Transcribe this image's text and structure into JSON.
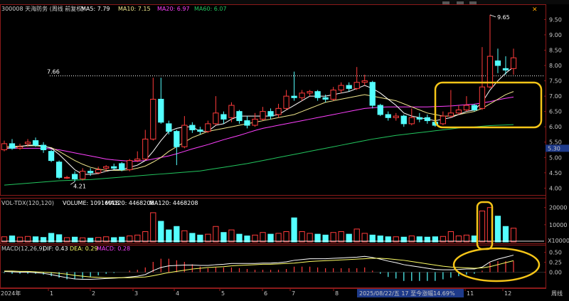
{
  "header": {
    "symbol": "300008 天海防务 (周线 前复权)",
    "ma5_label": "MA5: 7.79",
    "ma10_label": "MA10: 7.15",
    "ma20_label": "MA20: 6.97",
    "ma60_label": "MA60: 6.07"
  },
  "annotations": {
    "high": "9.65",
    "resistance": "7.66",
    "low": "4.21",
    "current_price": "5.30"
  },
  "volume_header": {
    "indicator": "VOL-TDX(120,120)",
    "volume": "VOLUME: 10916918",
    "ma120": "MA120: 4468208",
    "ma120b": "MA120: 4468208",
    "unit": "X10000"
  },
  "macd_header": {
    "indicator": "MACD(12,26,9)",
    "dif": "DIF: 0.43",
    "dea": "DEA: 0.29",
    "macd": "MACD: 0.28"
  },
  "bottom_bar": {
    "year": "2024年",
    "months": [
      "1",
      "2",
      "3",
      "4",
      "5",
      "6",
      "7",
      "8",
      "9",
      "10",
      "11",
      "12"
    ],
    "status": "2025/08/22/五 17 至今涨幅14.69%",
    "right_label": "周线"
  },
  "colors": {
    "up": "#ff3b3b",
    "down": "#54ffff",
    "ma5": "#ffffff",
    "ma10": "#f0e68c",
    "ma20": "#ff40ff",
    "ma60": "#22c55e",
    "highlight": "#f5c518"
  },
  "chart_data": [
    {
      "type": "candlestick",
      "title": "300008 天海防务 (周线 前复权)",
      "ylim": [
        3.8,
        9.95
      ],
      "y_ticks": [
        "9.50",
        "9.00",
        "8.50",
        "8.00",
        "7.50",
        "7.00",
        "6.50",
        "6.00",
        "5.50",
        "5.00",
        "4.50",
        "4.00"
      ],
      "candles": [
        {
          "o": 5.25,
          "c": 5.45,
          "h": 5.55,
          "l": 5.2
        },
        {
          "o": 5.45,
          "c": 5.3,
          "h": 5.6,
          "l": 5.25
        },
        {
          "o": 5.3,
          "c": 5.35,
          "h": 5.45,
          "l": 5.25
        },
        {
          "o": 5.45,
          "c": 5.5,
          "h": 5.6,
          "l": 5.35
        },
        {
          "o": 5.55,
          "c": 5.4,
          "h": 5.65,
          "l": 5.35
        },
        {
          "o": 5.4,
          "c": 5.25,
          "h": 5.5,
          "l": 5.15
        },
        {
          "o": 5.2,
          "c": 4.9,
          "h": 5.25,
          "l": 4.85
        },
        {
          "o": 4.85,
          "c": 4.35,
          "h": 4.9,
          "l": 4.3
        },
        {
          "o": 4.35,
          "c": 4.35,
          "h": 4.4,
          "l": 4.3
        },
        {
          "o": 4.45,
          "c": 4.3,
          "h": 4.55,
          "l": 4.21
        },
        {
          "o": 4.3,
          "c": 4.55,
          "h": 4.65,
          "l": 4.25
        },
        {
          "o": 4.55,
          "c": 4.5,
          "h": 4.65,
          "l": 4.4
        },
        {
          "o": 4.5,
          "c": 4.6,
          "h": 4.7,
          "l": 4.45
        },
        {
          "o": 4.65,
          "c": 4.7,
          "h": 4.75,
          "l": 4.55
        },
        {
          "o": 4.7,
          "c": 4.65,
          "h": 4.8,
          "l": 4.6
        },
        {
          "o": 4.8,
          "c": 4.6,
          "h": 4.85,
          "l": 4.55
        },
        {
          "o": 4.6,
          "c": 4.9,
          "h": 4.95,
          "l": 4.55
        },
        {
          "o": 4.9,
          "c": 4.95,
          "h": 5.2,
          "l": 4.85
        },
        {
          "o": 4.95,
          "c": 5.6,
          "h": 5.9,
          "l": 4.9
        },
        {
          "o": 5.6,
          "c": 6.9,
          "h": 7.6,
          "l": 5.55
        },
        {
          "o": 6.9,
          "c": 6.15,
          "h": 7.6,
          "l": 6.1
        },
        {
          "o": 6.1,
          "c": 5.85,
          "h": 6.2,
          "l": 5.75
        },
        {
          "o": 5.85,
          "c": 5.35,
          "h": 5.9,
          "l": 4.75
        },
        {
          "o": 5.35,
          "c": 6.05,
          "h": 6.35,
          "l": 5.3
        },
        {
          "o": 6.05,
          "c": 5.9,
          "h": 6.15,
          "l": 5.8
        },
        {
          "o": 5.9,
          "c": 5.85,
          "h": 6.0,
          "l": 5.75
        },
        {
          "o": 5.85,
          "c": 6.1,
          "h": 6.2,
          "l": 5.8
        },
        {
          "o": 6.1,
          "c": 6.45,
          "h": 7.0,
          "l": 6.05
        },
        {
          "o": 6.4,
          "c": 6.25,
          "h": 6.5,
          "l": 6.1
        },
        {
          "o": 6.3,
          "c": 6.7,
          "h": 6.8,
          "l": 6.15
        },
        {
          "o": 6.5,
          "c": 6.2,
          "h": 6.55,
          "l": 6.1
        },
        {
          "o": 6.2,
          "c": 6.05,
          "h": 6.35,
          "l": 5.95
        },
        {
          "o": 6.05,
          "c": 6.25,
          "h": 6.45,
          "l": 6.0
        },
        {
          "o": 6.25,
          "c": 6.5,
          "h": 6.65,
          "l": 6.2
        },
        {
          "o": 6.5,
          "c": 6.35,
          "h": 6.6,
          "l": 6.25
        },
        {
          "o": 6.4,
          "c": 6.6,
          "h": 6.75,
          "l": 6.3
        },
        {
          "o": 6.6,
          "c": 7.0,
          "h": 7.2,
          "l": 6.55
        },
        {
          "o": 7.0,
          "c": 6.95,
          "h": 7.8,
          "l": 6.85
        },
        {
          "o": 6.95,
          "c": 7.1,
          "h": 7.2,
          "l": 6.85
        },
        {
          "o": 7.1,
          "c": 7.15,
          "h": 7.2,
          "l": 7.0
        },
        {
          "o": 7.15,
          "c": 6.95,
          "h": 7.2,
          "l": 6.85
        },
        {
          "o": 6.95,
          "c": 6.9,
          "h": 7.05,
          "l": 6.8
        },
        {
          "o": 6.9,
          "c": 7.2,
          "h": 7.3,
          "l": 6.85
        },
        {
          "o": 7.2,
          "c": 7.35,
          "h": 7.45,
          "l": 7.1
        },
        {
          "o": 7.35,
          "c": 7.25,
          "h": 7.45,
          "l": 7.15
        },
        {
          "o": 7.25,
          "c": 7.45,
          "h": 7.95,
          "l": 7.2
        },
        {
          "o": 7.45,
          "c": 7.5,
          "h": 7.7,
          "l": 7.35
        },
        {
          "o": 7.45,
          "c": 6.7,
          "h": 7.5,
          "l": 6.6
        },
        {
          "o": 6.7,
          "c": 6.4,
          "h": 6.75,
          "l": 6.35
        },
        {
          "o": 6.4,
          "c": 6.3,
          "h": 6.5,
          "l": 6.2
        },
        {
          "o": 6.3,
          "c": 6.35,
          "h": 6.45,
          "l": 6.2
        },
        {
          "o": 6.35,
          "c": 6.1,
          "h": 6.4,
          "l": 6.0
        },
        {
          "o": 6.1,
          "c": 6.3,
          "h": 6.6,
          "l": 6.05
        },
        {
          "o": 6.3,
          "c": 6.25,
          "h": 6.45,
          "l": 6.15
        },
        {
          "o": 6.3,
          "c": 6.2,
          "h": 6.4,
          "l": 6.1
        },
        {
          "o": 6.15,
          "c": 6.05,
          "h": 6.25,
          "l": 6.0
        },
        {
          "o": 6.1,
          "c": 6.35,
          "h": 6.5,
          "l": 6.05
        },
        {
          "o": 6.35,
          "c": 6.45,
          "h": 7.2,
          "l": 6.3
        },
        {
          "o": 6.45,
          "c": 6.55,
          "h": 6.7,
          "l": 6.4
        },
        {
          "o": 6.55,
          "c": 6.7,
          "h": 7.0,
          "l": 6.5
        },
        {
          "o": 6.7,
          "c": 6.55,
          "h": 6.75,
          "l": 6.5
        },
        {
          "o": 6.6,
          "c": 7.3,
          "h": 8.6,
          "l": 6.55
        },
        {
          "o": 7.3,
          "c": 8.3,
          "h": 9.65,
          "l": 7.25
        },
        {
          "o": 8.15,
          "c": 8.0,
          "h": 8.55,
          "l": 7.75
        },
        {
          "o": 7.9,
          "c": 7.85,
          "h": 8.3,
          "l": 7.7
        },
        {
          "o": 7.9,
          "c": 8.25,
          "h": 8.55,
          "l": 7.7
        }
      ],
      "ma5": [
        5.3,
        5.32,
        5.35,
        5.4,
        5.4,
        5.38,
        5.3,
        5.1,
        4.85,
        4.6,
        4.45,
        4.45,
        4.48,
        4.55,
        4.6,
        4.6,
        4.68,
        4.75,
        4.9,
        5.2,
        5.55,
        5.85,
        5.95,
        6.0,
        6.0,
        5.85,
        5.85,
        6.05,
        6.1,
        6.25,
        6.35,
        6.35,
        6.35,
        6.35,
        6.35,
        6.4,
        6.55,
        6.7,
        6.85,
        7.0,
        7.0,
        7.0,
        7.05,
        7.1,
        7.15,
        7.25,
        7.35,
        7.25,
        7.1,
        6.9,
        6.7,
        6.45,
        6.35,
        6.3,
        6.25,
        6.2,
        6.25,
        6.3,
        6.4,
        6.5,
        6.55,
        6.8,
        7.2,
        7.5,
        7.75,
        7.95
      ],
      "ma10": [
        5.35,
        5.36,
        5.37,
        5.38,
        5.38,
        5.36,
        5.32,
        5.2,
        5.05,
        4.9,
        4.78,
        4.68,
        4.62,
        4.58,
        4.58,
        4.58,
        4.6,
        4.65,
        4.72,
        4.85,
        5.0,
        5.2,
        5.35,
        5.5,
        5.65,
        5.75,
        5.85,
        5.9,
        5.95,
        6.0,
        6.05,
        6.1,
        6.15,
        6.2,
        6.25,
        6.3,
        6.35,
        6.4,
        6.5,
        6.6,
        6.7,
        6.8,
        6.85,
        6.9,
        6.95,
        7.0,
        7.05,
        7.0,
        6.95,
        6.9,
        6.85,
        6.75,
        6.65,
        6.55,
        6.45,
        6.4,
        6.35,
        6.35,
        6.4,
        6.45,
        6.5,
        6.6,
        6.75,
        6.9,
        7.05,
        7.15
      ],
      "ma20": [
        5.3,
        5.3,
        5.3,
        5.3,
        5.3,
        5.3,
        5.28,
        5.25,
        5.2,
        5.15,
        5.1,
        5.05,
        5.0,
        4.95,
        4.92,
        4.9,
        4.88,
        4.88,
        4.9,
        4.95,
        5.0,
        5.05,
        5.12,
        5.2,
        5.28,
        5.35,
        5.42,
        5.5,
        5.58,
        5.65,
        5.72,
        5.8,
        5.88,
        5.95,
        6.0,
        6.05,
        6.1,
        6.15,
        6.2,
        6.25,
        6.3,
        6.35,
        6.4,
        6.45,
        6.5,
        6.55,
        6.6,
        6.62,
        6.64,
        6.65,
        6.65,
        6.65,
        6.65,
        6.65,
        6.65,
        6.66,
        6.67,
        6.68,
        6.7,
        6.72,
        6.74,
        6.78,
        6.82,
        6.88,
        6.93,
        6.97
      ],
      "ma60": [
        4.1,
        4.12,
        4.14,
        4.16,
        4.18,
        4.2,
        4.22,
        4.24,
        4.25,
        4.26,
        4.27,
        4.28,
        4.3,
        4.32,
        4.34,
        4.36,
        4.38,
        4.4,
        4.42,
        4.44,
        4.46,
        4.48,
        4.5,
        4.52,
        4.54,
        4.56,
        4.6,
        4.64,
        4.68,
        4.72,
        4.76,
        4.8,
        4.85,
        4.9,
        4.95,
        5.0,
        5.05,
        5.1,
        5.15,
        5.2,
        5.25,
        5.3,
        5.35,
        5.4,
        5.45,
        5.5,
        5.55,
        5.6,
        5.64,
        5.68,
        5.72,
        5.75,
        5.78,
        5.81,
        5.84,
        5.87,
        5.9,
        5.93,
        5.96,
        5.99,
        6.0,
        6.02,
        6.04,
        6.05,
        6.06,
        6.07
      ]
    },
    {
      "type": "bar",
      "title": "VOL-TDX(120,120)",
      "ylim": [
        0,
        24000
      ],
      "y_ticks": [
        "20000",
        "10000"
      ],
      "values": [
        3000,
        3500,
        2800,
        3200,
        3000,
        2600,
        5000,
        4200,
        2500,
        2800,
        2400,
        2200,
        2600,
        3000,
        2500,
        2800,
        3500,
        4000,
        6000,
        17000,
        12000,
        7000,
        9000,
        6500,
        5000,
        4000,
        4500,
        9000,
        5500,
        7000,
        4500,
        3500,
        4000,
        5500,
        4500,
        5000,
        6000,
        14000,
        6000,
        5000,
        4500,
        4000,
        5500,
        6000,
        4500,
        7500,
        5000,
        4000,
        3500,
        3000,
        3000,
        2800,
        3500,
        3000,
        2800,
        3000,
        3200,
        6000,
        3500,
        4000,
        3500,
        18000,
        20000,
        15000,
        9000,
        8000
      ],
      "ma": [
        4468208
      ]
    },
    {
      "type": "bar",
      "title": "MACD(12,26,9)",
      "ylim": [
        -0.35,
        0.62
      ],
      "y_ticks": [
        "0.50",
        "0.25",
        "0.00"
      ],
      "dif": [
        0.02,
        0.01,
        0.0,
        0.0,
        -0.01,
        -0.03,
        -0.06,
        -0.1,
        -0.14,
        -0.17,
        -0.18,
        -0.18,
        -0.17,
        -0.16,
        -0.15,
        -0.14,
        -0.12,
        -0.1,
        -0.06,
        0.04,
        0.12,
        0.16,
        0.17,
        0.18,
        0.18,
        0.17,
        0.17,
        0.19,
        0.2,
        0.22,
        0.22,
        0.22,
        0.22,
        0.23,
        0.23,
        0.24,
        0.26,
        0.3,
        0.32,
        0.34,
        0.34,
        0.34,
        0.35,
        0.36,
        0.37,
        0.38,
        0.4,
        0.37,
        0.33,
        0.28,
        0.24,
        0.19,
        0.16,
        0.13,
        0.1,
        0.07,
        0.06,
        0.06,
        0.07,
        0.08,
        0.08,
        0.13,
        0.26,
        0.33,
        0.38,
        0.43
      ],
      "dea": [
        0.03,
        0.03,
        0.02,
        0.02,
        0.01,
        0.0,
        -0.01,
        -0.03,
        -0.05,
        -0.08,
        -0.1,
        -0.12,
        -0.13,
        -0.14,
        -0.14,
        -0.14,
        -0.14,
        -0.13,
        -0.12,
        -0.09,
        -0.05,
        -0.01,
        0.02,
        0.05,
        0.08,
        0.1,
        0.12,
        0.13,
        0.14,
        0.16,
        0.17,
        0.18,
        0.19,
        0.2,
        0.2,
        0.21,
        0.22,
        0.23,
        0.25,
        0.27,
        0.28,
        0.29,
        0.3,
        0.31,
        0.32,
        0.33,
        0.34,
        0.35,
        0.35,
        0.34,
        0.32,
        0.3,
        0.27,
        0.24,
        0.21,
        0.18,
        0.15,
        0.13,
        0.12,
        0.11,
        0.1,
        0.11,
        0.14,
        0.19,
        0.24,
        0.29
      ],
      "macd": [
        -0.02,
        -0.04,
        -0.04,
        -0.04,
        -0.04,
        -0.06,
        -0.1,
        -0.14,
        -0.18,
        -0.18,
        -0.16,
        -0.12,
        -0.08,
        -0.04,
        -0.02,
        0.0,
        0.04,
        0.06,
        0.12,
        0.26,
        0.34,
        0.34,
        0.3,
        0.26,
        0.2,
        0.14,
        0.1,
        0.12,
        0.12,
        0.12,
        0.1,
        0.08,
        0.06,
        0.06,
        0.06,
        0.06,
        0.08,
        0.14,
        0.14,
        0.14,
        0.12,
        0.1,
        0.1,
        0.1,
        0.1,
        0.1,
        0.12,
        0.04,
        -0.04,
        -0.12,
        -0.16,
        -0.22,
        -0.22,
        -0.22,
        -0.22,
        -0.22,
        -0.18,
        -0.14,
        -0.1,
        -0.06,
        -0.04,
        0.04,
        0.24,
        0.28,
        0.28,
        0.28
      ]
    }
  ]
}
